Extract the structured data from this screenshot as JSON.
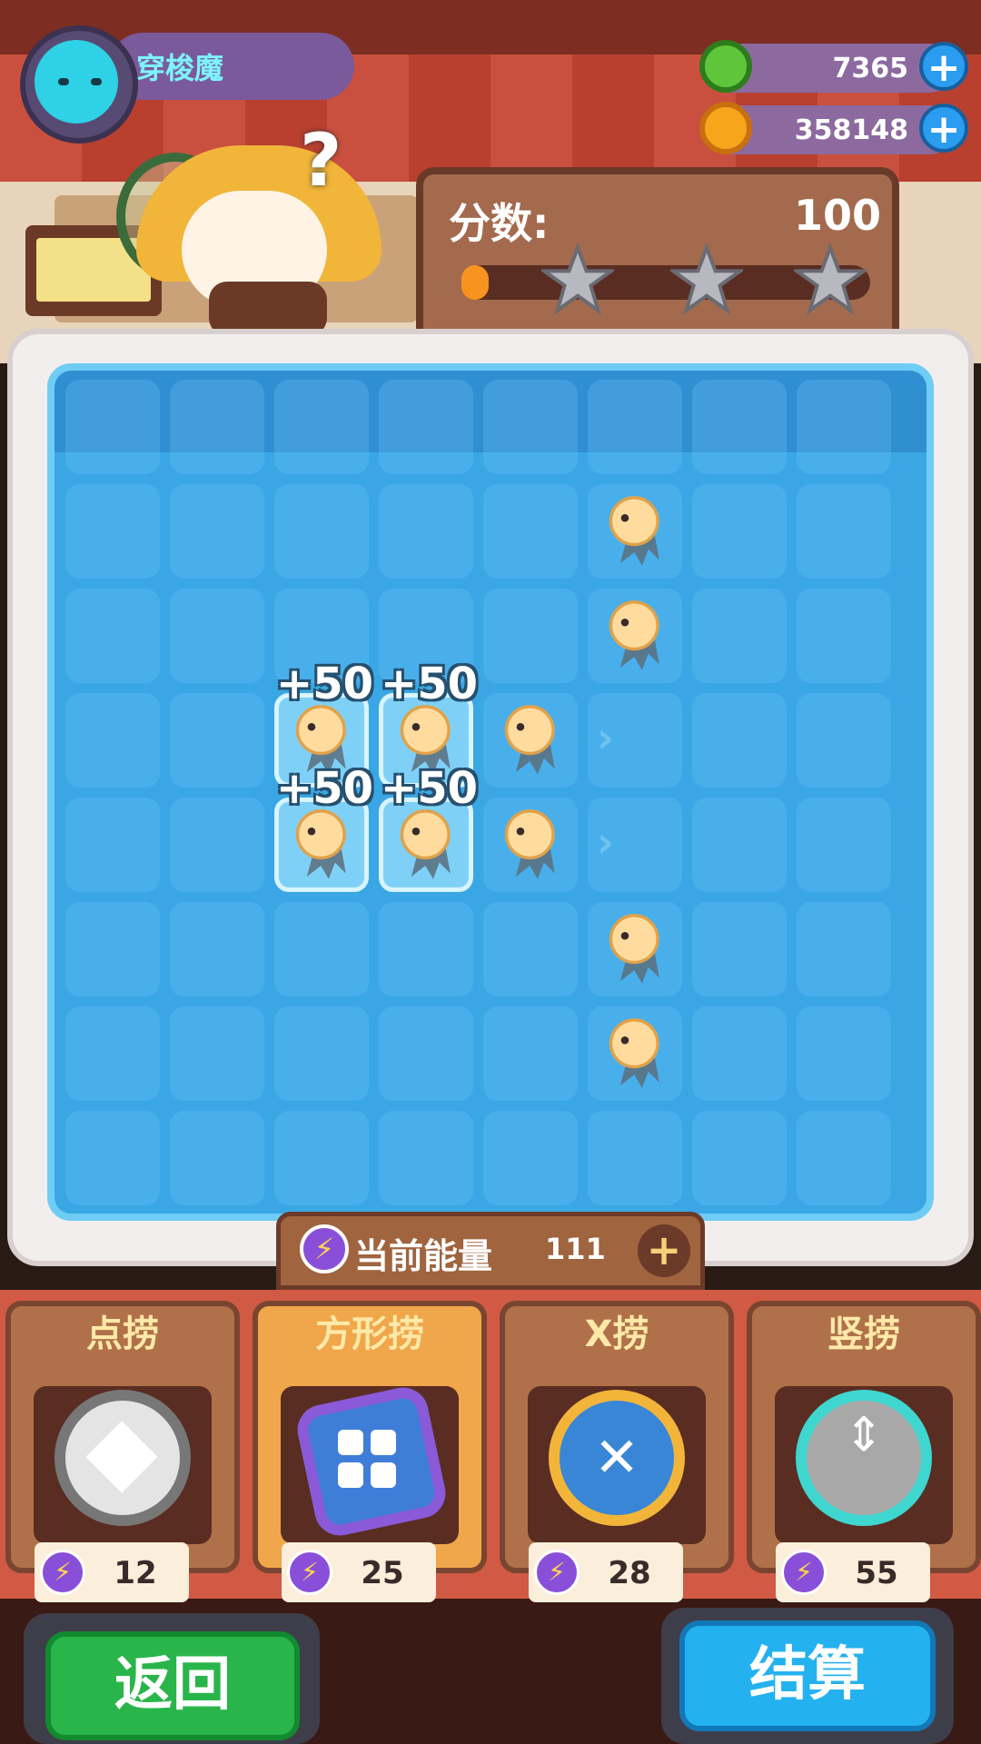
{
  "player": {
    "name": "穿梭魔",
    "avatar_icon": "cat-avatar-icon"
  },
  "currency": [
    {
      "icon": "green-gem-icon",
      "value": "7365"
    },
    {
      "icon": "gold-planet-coin-icon",
      "value": "358148"
    }
  ],
  "score": {
    "label": "分数:",
    "value": "100",
    "progress": 0.05,
    "stars_earned": 0,
    "stars_total": 3
  },
  "board": {
    "columns": 8,
    "rows": 8,
    "selected_cells": [
      [
        3,
        2
      ],
      [
        3,
        3
      ],
      [
        4,
        2
      ],
      [
        4,
        3
      ]
    ],
    "fish_cells": [
      [
        1,
        5
      ],
      [
        2,
        5
      ],
      [
        3,
        2
      ],
      [
        3,
        3
      ],
      [
        3,
        4
      ],
      [
        4,
        2
      ],
      [
        4,
        3
      ],
      [
        4,
        4
      ],
      [
        5,
        5
      ],
      [
        6,
        5
      ]
    ],
    "chevron_cells": [
      [
        3,
        5
      ],
      [
        4,
        5
      ]
    ],
    "score_popups": [
      {
        "row": 3,
        "col": 2,
        "text": "+50"
      },
      {
        "row": 3,
        "col": 3,
        "text": "+50"
      },
      {
        "row": 4,
        "col": 2,
        "text": "+50"
      },
      {
        "row": 4,
        "col": 3,
        "text": "+50"
      }
    ]
  },
  "energy": {
    "label": "当前能量",
    "value": "111"
  },
  "tools": [
    {
      "name": "点捞",
      "cost": "12",
      "icon": "point-net-icon",
      "active": false
    },
    {
      "name": "方形捞",
      "cost": "25",
      "icon": "square-net-icon",
      "active": true
    },
    {
      "name": "X捞",
      "cost": "28",
      "icon": "x-net-icon",
      "active": false
    },
    {
      "name": "竖捞",
      "cost": "55",
      "icon": "vertical-net-icon",
      "active": false
    }
  ],
  "buttons": {
    "back": "返回",
    "settle": "结算"
  },
  "colors": {
    "water": "#3aa7e4",
    "back_green": "#2ab54a",
    "settle_blue": "#24b1ef",
    "energy_purple": "#8a4fd9"
  }
}
